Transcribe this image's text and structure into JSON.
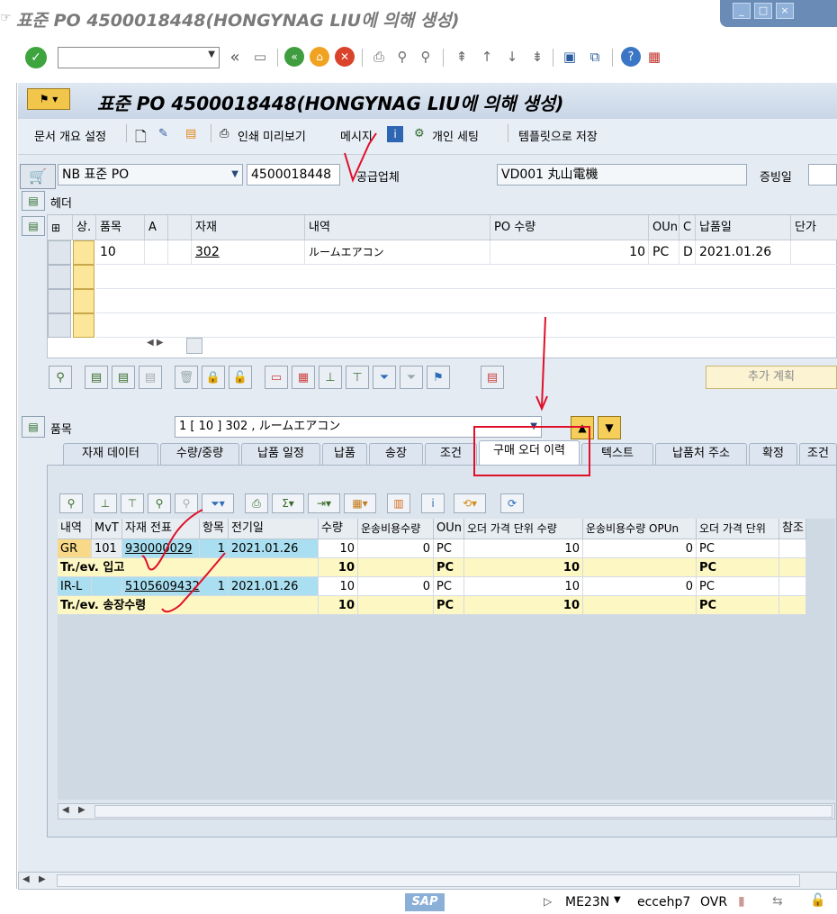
{
  "window": {
    "title": "표준 PO 4500018448(HONGYNAG LIU에 의해 생성)",
    "buttons": [
      "_",
      "□",
      "×"
    ]
  },
  "toolbar": {
    "command_value": "",
    "back_label": "«"
  },
  "screen": {
    "title": "표준 PO 4500018448(HONGYNAG LIU에 의해 생성)"
  },
  "app_toolbar": {
    "doc_overview": "문서 개요 설정",
    "print_preview": "인쇄 미리보기",
    "messages": "메시지",
    "personal_settings": "개인 세팅",
    "save_template": "템플릿으로 저장"
  },
  "header_fields": {
    "doc_type": "NB 표준 PO",
    "po_number": "4500018448",
    "vendor_label": "공급업체",
    "vendor_value": "VD001 丸山電機",
    "doc_date_label": "증빙일",
    "header_label": "헤더"
  },
  "items_grid": {
    "columns": [
      "상.",
      "품목",
      "A",
      "",
      "자재",
      "내역",
      "PO 수량",
      "OUn",
      "C",
      "납품일",
      "단가"
    ],
    "rows": [
      {
        "item": "10",
        "material": "302",
        "desc": "ルームエアコン",
        "qty": "10",
        "oun": "PC",
        "c": "D",
        "delivery": "2021.01.26"
      }
    ],
    "add_plan_button": "추가 계획"
  },
  "item_detail": {
    "label": "품목",
    "selected": "1 [ 10 ] 302 , ルームエアコン"
  },
  "tabs": [
    "자재 데이터",
    "수량/중량",
    "납품 일정",
    "납품",
    "송장",
    "조건",
    "구매 오더 이력",
    "텍스트",
    "납품처 주소",
    "확정",
    "조건"
  ],
  "active_tab": "구매 오더 이력",
  "history_grid": {
    "columns": [
      "내역",
      "MvT",
      "자재 전표",
      "항목",
      "전기일",
      "수량",
      "운송비용수량",
      "OUn",
      "오더 가격 단위 수량",
      "운송비용수량 OPUn",
      "오더 가격 단위",
      "참조"
    ],
    "rows": [
      {
        "type": "GR",
        "mvt": "101",
        "doc": "930000029",
        "item": "1",
        "date": "2021.01.26",
        "qty": "10",
        "freight": "0",
        "oun": "PC",
        "opu_qty": "10",
        "opun_freight": "0",
        "opu": "PC",
        "ref": ""
      },
      {
        "type": "Tr./ev. 입고",
        "mvt": "",
        "doc": "",
        "item": "",
        "date": "",
        "qty": "10",
        "freight": "",
        "oun": "PC",
        "opu_qty": "10",
        "opun_freight": "",
        "opu": "PC",
        "ref": "",
        "sum": true
      },
      {
        "type": "IR-L",
        "mvt": "",
        "doc": "5105609432",
        "item": "1",
        "date": "2021.01.26",
        "qty": "10",
        "freight": "0",
        "oun": "PC",
        "opu_qty": "10",
        "opun_freight": "0",
        "opu": "PC",
        "ref": ""
      },
      {
        "type": "Tr./ev. 송장수령",
        "mvt": "",
        "doc": "",
        "item": "",
        "date": "",
        "qty": "10",
        "freight": "",
        "oun": "PC",
        "opu_qty": "10",
        "opun_freight": "",
        "opu": "PC",
        "ref": "",
        "sum": true
      }
    ]
  },
  "statusbar": {
    "logo": "SAP",
    "transaction": "ME23N",
    "server": "eccehp7",
    "mode": "OVR"
  }
}
